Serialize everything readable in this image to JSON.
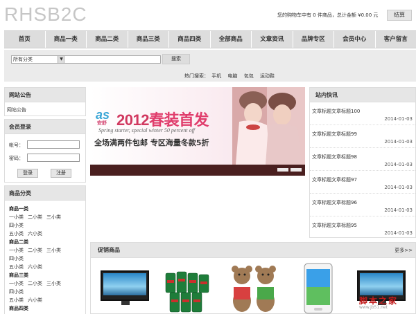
{
  "logo": "RHSB2C",
  "cart": {
    "text": "您的购物车中有 0 件商品，总计金额 ¥0.00 元",
    "checkout_label": "结算"
  },
  "nav": [
    "首页",
    "商品一类",
    "商品二类",
    "商品三类",
    "商品四类",
    "全部商品",
    "文章资讯",
    "品牌专区",
    "会员中心",
    "客户留言"
  ],
  "search": {
    "category": "所有分类",
    "button": "搜索",
    "hot_label": "热门搜索：",
    "hot_terms": [
      "手机",
      "电脑",
      "包包",
      "运动鞋"
    ]
  },
  "notice": {
    "title": "网站公告",
    "body": "网站公告"
  },
  "login": {
    "title": "会员登录",
    "username_label": "帐号：",
    "password_label": "密码：",
    "login_button": "登录",
    "register_button": "注册"
  },
  "categories": {
    "title": "商品分类",
    "groups": [
      {
        "name": "商品一类",
        "line1": [
          "一小类",
          "二小类",
          "三小类",
          "四小类"
        ],
        "line2": [
          "五小类",
          "六小类"
        ]
      },
      {
        "name": "商品二类",
        "line1": [
          "一小类",
          "二小类",
          "三小类",
          "四小类"
        ],
        "line2": [
          "五小类",
          "六小类"
        ]
      },
      {
        "name": "商品三类",
        "line1": [
          "一小类",
          "二小类",
          "三小类",
          "四小类"
        ],
        "line2": [
          "五小类",
          "六小类"
        ]
      },
      {
        "name": "商品四类"
      }
    ]
  },
  "banner": {
    "brand": "as",
    "brand_sub": "安舒",
    "year": "2012",
    "headline": "春装首发",
    "subline": "Spring starter, special winter 50 percent off",
    "promo": "全场满两件包邮  专区海量冬款5折"
  },
  "news": {
    "title": "站内快讯",
    "items": [
      {
        "title": "文章标题文章标题100",
        "date": "2014-01-03"
      },
      {
        "title": "文章标题文章标题99",
        "date": "2014-01-03"
      },
      {
        "title": "文章标题文章标题98",
        "date": "2014-01-03"
      },
      {
        "title": "文章标题文章标题97",
        "date": "2014-01-03"
      },
      {
        "title": "文章标题文章标题96",
        "date": "2014-01-03"
      },
      {
        "title": "文章标题文章标题95",
        "date": "2014-01-03"
      }
    ]
  },
  "promo": {
    "title": "促销商品",
    "more": "更多>>"
  },
  "watermark": {
    "text": "脚本之家",
    "url": "www.jb51.net"
  }
}
